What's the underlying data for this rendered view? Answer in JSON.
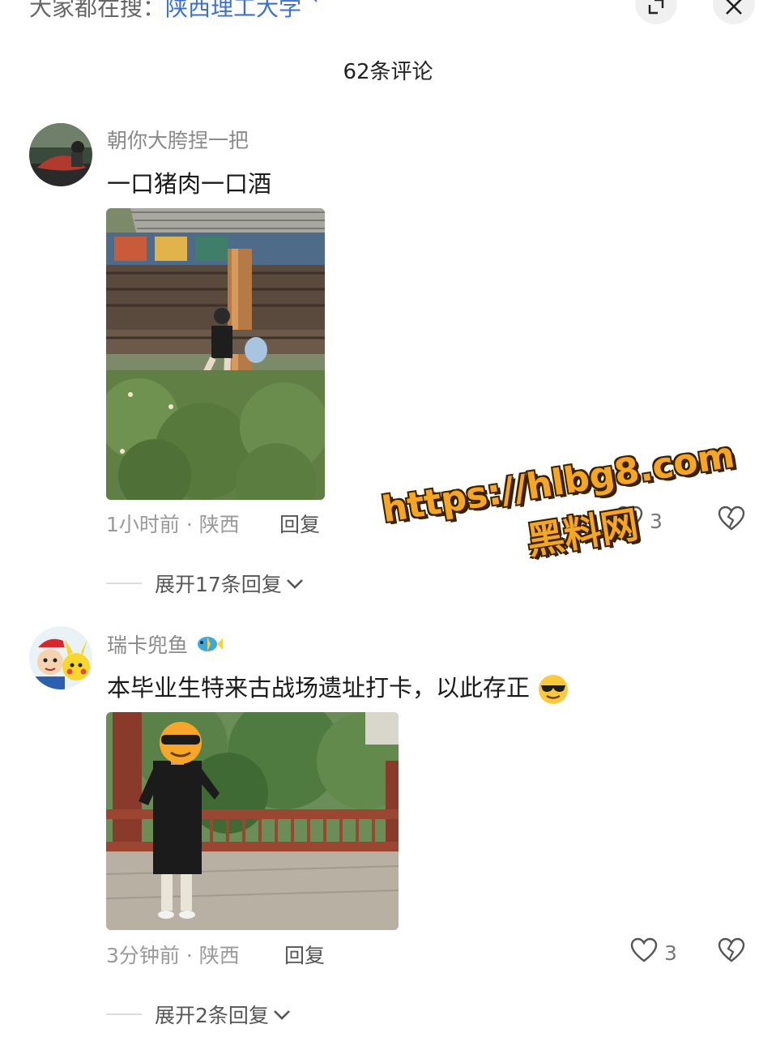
{
  "header": {
    "search_prefix": "大家都在搜：",
    "search_keyword": "陕西理工大学",
    "comment_count": "62条评论"
  },
  "comments": [
    {
      "username": "朝你大胯捏一把",
      "text": "一口猪肉一口酒",
      "meta": "1小时前 · 陕西",
      "reply_label": "回复",
      "likes": "3",
      "expand_label": "展开17条回复"
    },
    {
      "username": "瑞卡兜鱼",
      "text": "本毕业生特来古战场遗址打卡，以此存正",
      "meta": "3分钟前 · 陕西",
      "reply_label": "回复",
      "likes": "3",
      "expand_label": "展开2条回复"
    }
  ],
  "watermark": {
    "url": "https://hlbg8.com",
    "name": "黑料网"
  },
  "icons": {
    "search": "search-icon",
    "expand": "expand-icon",
    "close": "close-icon",
    "like": "heart-icon",
    "dislike": "broken-heart-icon",
    "chevron": "chevron-down-icon"
  }
}
